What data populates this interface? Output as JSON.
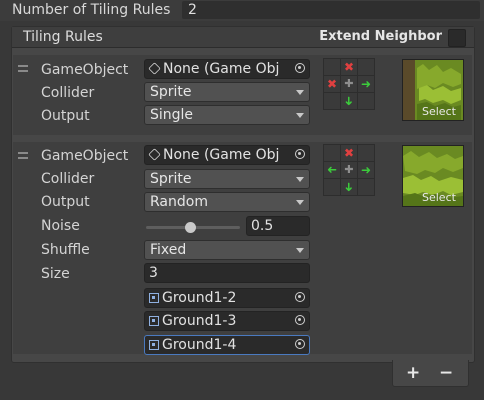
{
  "top": {
    "label": "Number of Tiling Rules",
    "value": "2"
  },
  "panel": {
    "title": "Tiling Rules",
    "extend_label": "Extend Neighbor"
  },
  "rule1": {
    "gameobject_label": "GameObject",
    "gameobject_value": "None (Game Obj",
    "collider_label": "Collider",
    "collider_value": "Sprite",
    "output_label": "Output",
    "output_value": "Single",
    "select_label": "Select"
  },
  "rule2": {
    "gameobject_label": "GameObject",
    "gameobject_value": "None (Game Obj",
    "collider_label": "Collider",
    "collider_value": "Sprite",
    "output_label": "Output",
    "output_value": "Random",
    "noise_label": "Noise",
    "noise_value": "0.5",
    "shuffle_label": "Shuffle",
    "shuffle_value": "Fixed",
    "size_label": "Size",
    "size_value": "3",
    "sprites": [
      "Ground1-2",
      "Ground1-3",
      "Ground1-4"
    ],
    "select_label": "Select"
  },
  "footer": {
    "add": "+",
    "remove": "−"
  },
  "colors": {
    "blocked": "#e04040",
    "required": "#3ccc3c",
    "accent": "#4a7ac0"
  }
}
